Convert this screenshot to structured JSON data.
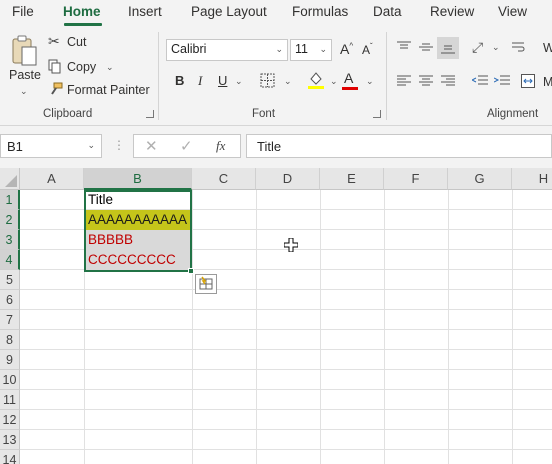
{
  "menu": {
    "tabs": [
      "File",
      "Home",
      "Insert",
      "Page Layout",
      "Formulas",
      "Data",
      "Review",
      "View"
    ],
    "active": "Home"
  },
  "ribbon": {
    "clipboard": {
      "paste": "Paste",
      "cut": "Cut",
      "copy": "Copy",
      "format_painter": "Format Painter",
      "group_label": "Clipboard"
    },
    "font": {
      "font_name": "Calibri",
      "font_size": "11",
      "bold": "B",
      "italic": "I",
      "underline": "U",
      "font_color_glyph": "A",
      "group_label": "Font",
      "highlight_color": "#ffff00",
      "font_color": "#e00000"
    },
    "alignment": {
      "group_label": "Alignment",
      "wrap_partial": "W",
      "merge_partial": "M"
    }
  },
  "formula_bar": {
    "name_box": "B1",
    "fx_label": "fx",
    "formula": "Title"
  },
  "sheet": {
    "columns": [
      "A",
      "B",
      "C",
      "D",
      "E",
      "F",
      "G",
      "H"
    ],
    "selected_column": "B",
    "rows": [
      "1",
      "2",
      "3",
      "4",
      "5",
      "6",
      "7",
      "8",
      "9",
      "10",
      "11",
      "12",
      "13",
      "14"
    ],
    "selected_rows": [
      "1",
      "2",
      "3",
      "4"
    ],
    "cells": {
      "B1": "Title",
      "B2": "AAAAAAAAAAA",
      "B3": "BBBBB",
      "B4": "CCCCCCCCC"
    },
    "styles": {
      "B2_fill": "#c5c51a",
      "B3_font_color": "#c00000",
      "B4_font_color": "#c00000"
    }
  },
  "colors": {
    "accent": "#217346",
    "ribbon_bg": "#f3f3f3"
  }
}
